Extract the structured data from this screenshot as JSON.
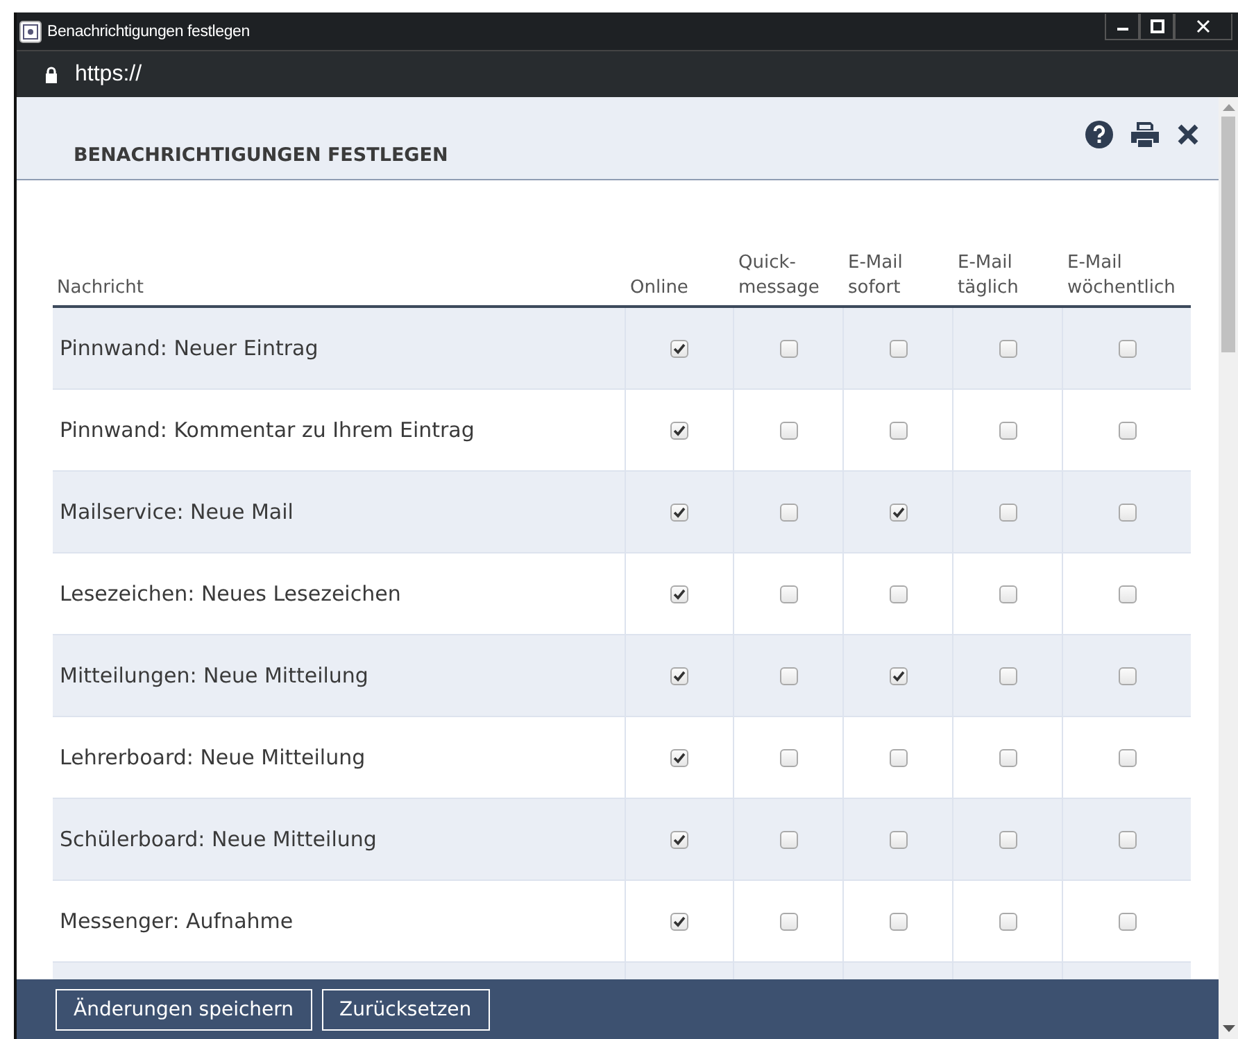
{
  "window": {
    "title": "Benachrichtigungen festlegen",
    "url": "https://"
  },
  "panel": {
    "title": "BENACHRICHTIGUNGEN FESTLEGEN"
  },
  "table": {
    "columns": [
      {
        "label": "Nachricht"
      },
      {
        "label": "Online"
      },
      {
        "label": "Quick-\nmessage"
      },
      {
        "label": "E-Mail\nsofort"
      },
      {
        "label": "E-Mail\ntäglich"
      },
      {
        "label": "E-Mail\nwöchentlich"
      }
    ],
    "rows": [
      {
        "message": "Pinnwand: Neuer Eintrag",
        "options": [
          {
            "checked": true
          },
          {
            "checked": false
          },
          {
            "checked": false
          },
          {
            "checked": false
          },
          {
            "checked": false
          }
        ]
      },
      {
        "message": "Pinnwand: Kommentar zu Ihrem Eintrag",
        "options": [
          {
            "checked": true
          },
          {
            "checked": false
          },
          {
            "checked": false
          },
          {
            "checked": false
          },
          {
            "checked": false
          }
        ]
      },
      {
        "message": "Mailservice: Neue Mail",
        "options": [
          {
            "checked": true
          },
          {
            "checked": false
          },
          {
            "checked": true
          },
          {
            "checked": false
          },
          {
            "checked": false
          }
        ]
      },
      {
        "message": "Lesezeichen: Neues Lesezeichen",
        "options": [
          {
            "checked": true
          },
          {
            "checked": false
          },
          {
            "checked": false
          },
          {
            "checked": false
          },
          {
            "checked": false
          }
        ]
      },
      {
        "message": "Mitteilungen: Neue Mitteilung",
        "options": [
          {
            "checked": true
          },
          {
            "checked": false
          },
          {
            "checked": true
          },
          {
            "checked": false
          },
          {
            "checked": false
          }
        ]
      },
      {
        "message": "Lehrerboard: Neue Mitteilung",
        "options": [
          {
            "checked": true
          },
          {
            "checked": false
          },
          {
            "checked": false
          },
          {
            "checked": false
          },
          {
            "checked": false
          }
        ]
      },
      {
        "message": "Schülerboard: Neue Mitteilung",
        "options": [
          {
            "checked": true
          },
          {
            "checked": false
          },
          {
            "checked": false
          },
          {
            "checked": false
          },
          {
            "checked": false
          }
        ]
      },
      {
        "message": "Messenger: Aufnahme",
        "options": [
          {
            "checked": true
          },
          {
            "checked": false
          },
          {
            "checked": false
          },
          {
            "checked": false
          },
          {
            "checked": false
          }
        ]
      }
    ]
  },
  "buttons": [
    "Änderungen speichern",
    "Zurücksetzen"
  ]
}
